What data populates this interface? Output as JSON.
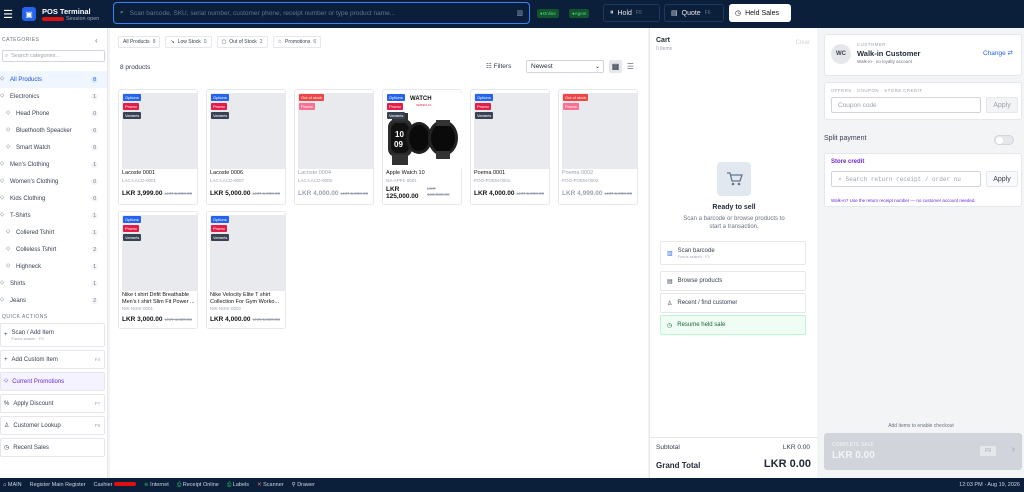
{
  "topbar": {
    "title": "POS Terminal",
    "subtitle": "Session open",
    "search_placeholder": "Scan barcode, SKU, serial number, customer phone, receipt number or type product name...",
    "online": "Online",
    "agent": "Agent",
    "hold": "Hold",
    "hold_key": "F5",
    "quote": "Quote",
    "quote_key": "F6",
    "held_sales": "Held Sales"
  },
  "sidebar": {
    "heading": "CATEGORIES",
    "search_placeholder": "Search categories...",
    "categories": [
      {
        "label": "All Products",
        "count": "8"
      },
      {
        "label": "Electronics",
        "count": "1"
      },
      {
        "label": "Head Phone",
        "count": "0"
      },
      {
        "label": "Bluethooth Speacker",
        "count": "0"
      },
      {
        "label": "Smart Watch",
        "count": "0"
      },
      {
        "label": "Men's Clothing",
        "count": "1"
      },
      {
        "label": "Women's Clothing",
        "count": "0"
      },
      {
        "label": "Kids Clothing",
        "count": "0"
      },
      {
        "label": "T-Shirts",
        "count": "1"
      },
      {
        "label": "Collered Tshirt",
        "count": "1"
      },
      {
        "label": "Colleless Tshirt",
        "count": "2"
      },
      {
        "label": "Highneck",
        "count": "1"
      },
      {
        "label": "Shirts",
        "count": "1"
      },
      {
        "label": "Jeans",
        "count": "2"
      }
    ],
    "quick_heading": "QUICK ACTIONS",
    "actions": [
      {
        "label": "Scan / Add Item",
        "sub": "Focus search · F2"
      },
      {
        "label": "Add Custom Item",
        "key": "F4"
      },
      {
        "label": "Current Promotions"
      },
      {
        "label": "Apply Discount",
        "key": "F7"
      },
      {
        "label": "Customer Lookup",
        "key": "F8"
      },
      {
        "label": "Recent Sales"
      }
    ]
  },
  "filters": [
    {
      "label": "All Products",
      "count": "8"
    },
    {
      "label": "Low Stock",
      "count": "0"
    },
    {
      "label": "Out of Stock",
      "count": "2"
    },
    {
      "label": "Promotions",
      "count": "6"
    }
  ],
  "products_count": "8 products",
  "filters_btn": "Filters",
  "sort": "Newest",
  "badges": {
    "options": "Options",
    "promo": "Promo",
    "variants": "Variants",
    "oos": "Out of stock"
  },
  "products": [
    {
      "name": "Lacoste 0001",
      "sku": "LAC-LACO-0001",
      "price": "LKR 3,999.00",
      "old": "LKR 5,000.00"
    },
    {
      "name": "Lacoste 0006",
      "sku": "LAC-LACO-0007",
      "price": "LKR 5,000.00",
      "old": "LKR 6,000.00"
    },
    {
      "name": "Lacoste 0004",
      "sku": "LAC-LACO-0005",
      "price": "LKR 4,000.00",
      "old": "LKR 5,000.00"
    },
    {
      "name": "Apple Watch 10",
      "sku": "NA-APPL-0001",
      "price": "LKR 125,000.00",
      "old": "LKR 128,000.00"
    },
    {
      "name": "Poema 0001",
      "sku": "POO-POEM-0001",
      "price": "LKR 4,000.00",
      "old": "LKR 5,000.00"
    },
    {
      "name": "Poema 0002",
      "sku": "POO-POEM-0002",
      "price": "LKR 4,999.00",
      "old": "LKR 6,000.00"
    },
    {
      "name": "Nike t shirt Drifit Breathable Men's t shirt Slim Fit Power ...",
      "sku": "NIK-NIKE-0001",
      "price": "LKR 3,000.00",
      "old": "LKR 4,000.00"
    },
    {
      "name": "Nike Velocity Elite T shirt Collection For Gym Worko...",
      "sku": "NIK-NIKE-0002",
      "price": "LKR 4,000.00",
      "old": "LKR 5,000.00"
    }
  ],
  "watch_label": "WATCH",
  "watch_series": "SERIES 10",
  "cart": {
    "title": "Cart",
    "items": "0 items",
    "clear": "Clear",
    "ready": "Ready to sell",
    "ready_sub": "Scan a barcode or browse products to start a transaction.",
    "actions": [
      {
        "label": "Scan barcode",
        "sub": "Focus search · F2"
      },
      {
        "label": "Browse products"
      },
      {
        "label": "Recent / find customer"
      },
      {
        "label": "Resume held sale"
      }
    ],
    "subtotal_label": "Subtotal",
    "subtotal": "LKR 0.00",
    "grand_label": "Grand Total",
    "grand": "LKR 0.00"
  },
  "customer": {
    "label": "CUSTOMER",
    "initials": "WC",
    "name": "Walk-in Customer",
    "sub": "Walk-in · no loyalty account",
    "change": "Change"
  },
  "coupon": {
    "label": "OFFERS · COUPON · STORE CREDIT",
    "placeholder": "Coupon code",
    "apply": "Apply"
  },
  "split": "Split payment",
  "credit": {
    "title": "Store credit",
    "placeholder": "Search return receipt / order nu",
    "apply": "Apply",
    "hint": "Walk-in? Use the return receipt number — no customer account needed."
  },
  "checkout": {
    "hint": "Add items to enable checkout",
    "label": "COMPLETE SALE",
    "amount": "LKR 0.00",
    "key": "F9"
  },
  "status": {
    "main": "MAIN",
    "register": "Register Main Register",
    "cashier": "Cashier",
    "internet": "Internet",
    "receipt": "Receipt Online",
    "labels": "Labels",
    "scanner": "Scanner",
    "drawer": "Drawer",
    "datetime": "12:03 PM · Aug 19, 2026"
  }
}
